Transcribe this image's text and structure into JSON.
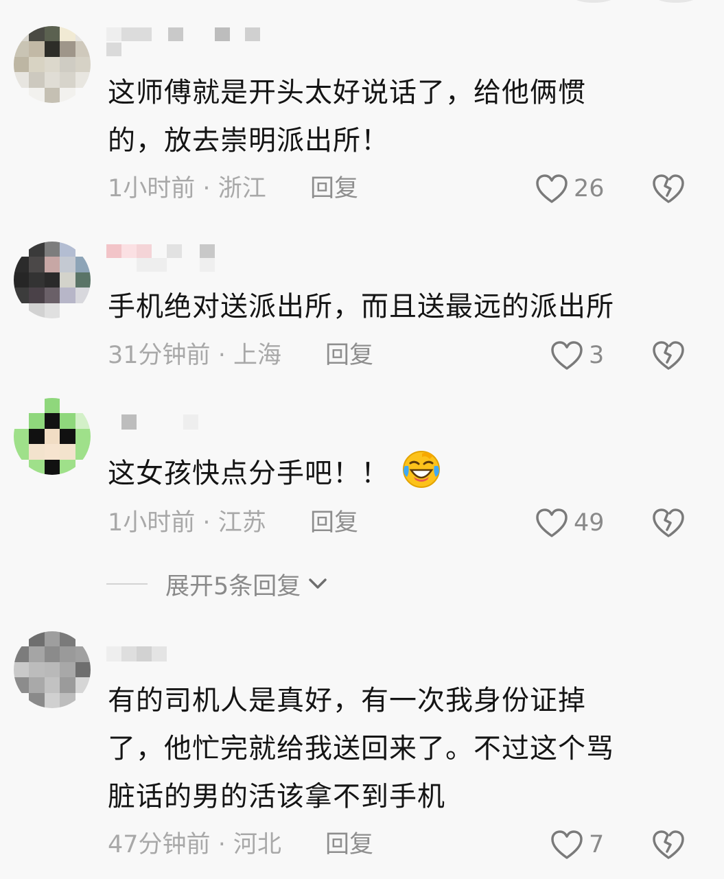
{
  "comments": [
    {
      "text_lines": [
        "这师傅就是开头太好说话了，给他俩惯",
        "的，放去崇明派出所！"
      ],
      "time": "1小时前",
      "location": "浙江",
      "reply_label": "回复",
      "likes": "26"
    },
    {
      "text_lines": [
        "手机绝对送派出所，而且送最远的派出所"
      ],
      "time": "31分钟前",
      "location": "上海",
      "reply_label": "回复",
      "likes": "3"
    },
    {
      "text_lines": [
        "这女孩快点分手吧！！"
      ],
      "emoji": "laughing-crying-face",
      "time": "1小时前",
      "location": "江苏",
      "reply_label": "回复",
      "likes": "49",
      "expand_label": "展开5条回复"
    },
    {
      "text_lines": [
        "有的司机人是真好，有一次我身份证掉",
        "了，他忙完就给我送回来了。不过这个骂",
        "脏话的男的活该拿不到手机"
      ],
      "time": "47分钟前",
      "location": "河北",
      "reply_label": "回复",
      "likes": "7"
    }
  ],
  "icons": {
    "like": "heart-outline-icon",
    "dislike": "broken-heart-icon",
    "expand": "chevron-down-icon"
  },
  "separator": "·"
}
